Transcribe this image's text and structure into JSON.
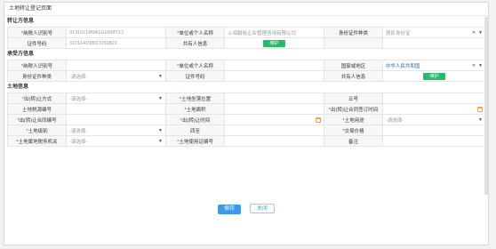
{
  "window": {
    "title": "土地转让登记页面"
  },
  "transferor": {
    "section_title": "转让方信息",
    "taxpayer_id_label": "纳税人识别号",
    "taxpayer_id_value": "91310114MA1GU6MY1J",
    "unit_name_label": "单位或个人名称",
    "unit_name_value": "上海毅裕企业管理咨询有限公司",
    "id_type_label": "身份证件种类",
    "id_type_value": "居民身份证",
    "id_no_label": "证件号码",
    "id_no_value": "310114198511150821",
    "co_owner_label": "共有人信息",
    "maintain_label": "维护"
  },
  "transferee": {
    "section_title": "承受方信息",
    "taxpayer_id_label": "纳税人识别号",
    "unit_name_label": "单位或个人名称",
    "country_label": "国家或地区",
    "country_value": "中华人民共和国",
    "id_type_label": "身份证件种类",
    "id_type_value": "-请选择-",
    "id_no_label": "证件号码",
    "co_owner_label": "共有人信息",
    "maintain_label": "维护"
  },
  "land": {
    "section_title": "土地信息",
    "transfer_method_label": "出(转)让方式",
    "transfer_method_value": "-请选择-",
    "location_label": "土地坐落位置",
    "hill_no_label": "丘号",
    "tax_source_label": "土地税源编号",
    "area_label": "土地面积",
    "contract_date_label": "出(转)让合同签订时间",
    "contract_no_label": "出(转)让合同编号",
    "transfer_time_label": "出(转)让时间",
    "land_use_label": "土地用途",
    "land_use_value": "-请选择-",
    "grade_label": "土地级别",
    "grade_value": "-请选择-",
    "boundary_label": "四至",
    "price_label": "交易价格",
    "authority_label": "土地属地税务机关",
    "authority_value": "-请选择-",
    "cert_no_label": "土地使用证编号",
    "remark_label": "备注"
  },
  "footer": {
    "save_label": "保存",
    "close_label": "关闭"
  }
}
